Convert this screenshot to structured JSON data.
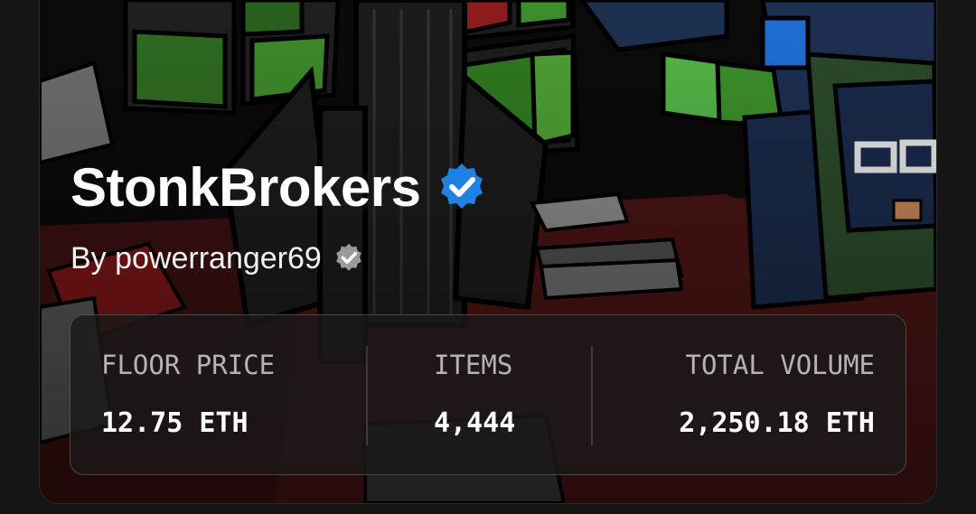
{
  "collection": {
    "title": "StonkBrokers",
    "creator": "By powerranger69"
  },
  "stats": [
    {
      "label": "FLOOR PRICE",
      "value": "12.75 ETH"
    },
    {
      "label": "ITEMS",
      "value": "4,444"
    },
    {
      "label": "TOTAL VOLUME",
      "value": "2,250.18 ETH"
    }
  ],
  "icons": {
    "title_badge": "verified-check-icon",
    "creator_badge": "verified-check-icon"
  },
  "colors": {
    "verified_blue": "#2081e2",
    "creator_badge_gray": "#9a9a9a",
    "accent_green": "#3d8f2a",
    "accent_red": "#8e1c1c"
  }
}
